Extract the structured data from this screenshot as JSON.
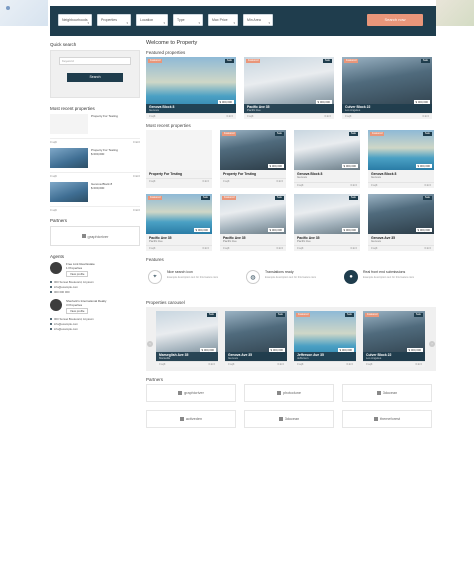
{
  "header": {
    "filters": [
      "Neighbourhoods",
      "Properties",
      "Location",
      "Type",
      "Max Price",
      "Min Area"
    ],
    "search_label": "Search now"
  },
  "sidebar": {
    "quick_search_title": "Quick search",
    "quick_search_placeholder": "Keyword",
    "quick_search_button": "Search",
    "recent_title": "Most recent properties",
    "recent": [
      {
        "title": "Property For Testing",
        "price": "",
        "meta_left": "0 sqft",
        "meta_right": "0 ⊞ 0"
      },
      {
        "title": "Property For Testing",
        "price": "$ 000,000",
        "meta_left": "0 sqft",
        "meta_right": "0 ⊞ 0"
      },
      {
        "title": "Genova Block 8",
        "price": "$ 000,000",
        "meta_left": "0 sqft",
        "meta_right": "0 ⊞ 0"
      }
    ],
    "partners_title": "Partners",
    "partner_name": "graphicriver",
    "agents_title": "Agents",
    "agents": [
      {
        "name": "Free Link Real Estate",
        "role": "1 Properties",
        "link": "View profile",
        "contacts": [
          "000 Sunset Boulevard, Anytown",
          "info@example.com",
          "000 000 000"
        ]
      },
      {
        "name": "Sherlock's International Realty",
        "role": "3 Properties",
        "link": "View profile",
        "contacts": [
          "000 Sunset Boulevard, Anytown",
          "info@example.com",
          "info@example.com"
        ]
      }
    ]
  },
  "main": {
    "welcome": "Welcome to Property",
    "featured_title": "Featured properties",
    "featured": [
      {
        "badge": "Featured",
        "status": "Sale",
        "price": "$ 000,000",
        "title": "Genova Block 8",
        "sub": "Genova",
        "meta_left": "0 sqft",
        "meta_right": "0 ⊞ 0",
        "photo": "pool"
      },
      {
        "badge": "Featured",
        "status": "Sale",
        "price": "$ 000,000",
        "title": "Pacific Ave 35",
        "sub": "Pacific Ave",
        "meta_left": "0 sqft",
        "meta_right": "0 ⊞ 0",
        "photo": "light"
      },
      {
        "badge": "Featured",
        "status": "Sale",
        "price": "$ 000,000",
        "title": "Culver Block 22",
        "sub": "Los Angeles",
        "meta_left": "0 sqft",
        "meta_right": "0 ⊞ 0",
        "photo": "dark"
      }
    ],
    "recent_title": "Most recent properties",
    "recent_row1": [
      {
        "badge": "",
        "status": "",
        "price": "",
        "title": "Property For Testing",
        "sub": "",
        "meta_left": "0 sqft",
        "meta_right": "0 ⊞ 0",
        "photo": "empty"
      },
      {
        "badge": "Featured",
        "status": "Sale",
        "price": "$ 000,000",
        "title": "Property For Testing",
        "sub": "",
        "meta_left": "0 sqft",
        "meta_right": "0 ⊞ 0",
        "photo": "dark"
      },
      {
        "badge": "",
        "status": "Sale",
        "price": "$ 000,000",
        "title": "Genova Block 8",
        "sub": "Genova",
        "meta_left": "0 sqft",
        "meta_right": "0 ⊞ 0",
        "photo": "light"
      },
      {
        "badge": "Featured",
        "status": "Sale",
        "price": "$ 000,000",
        "title": "Genova Block 8",
        "sub": "Genova",
        "meta_left": "0 sqft",
        "meta_right": "0 ⊞ 0",
        "photo": "pool"
      }
    ],
    "recent_row2": [
      {
        "badge": "Featured",
        "status": "Sale",
        "price": "$ 000,000",
        "title": "Pacific Ave 35",
        "sub": "Pacific Ave",
        "meta_left": "0 sqft",
        "meta_right": "0 ⊞ 0",
        "photo": "pool"
      },
      {
        "badge": "Featured",
        "status": "Sale",
        "price": "$ 000,000",
        "title": "Pacific Ave 35",
        "sub": "Pacific Ave",
        "meta_left": "0 sqft",
        "meta_right": "0 ⊞ 0",
        "photo": "light"
      },
      {
        "badge": "",
        "status": "Sale",
        "price": "$ 000,000",
        "title": "Pacific Ave 35",
        "sub": "Pacific Ave",
        "meta_left": "0 sqft",
        "meta_right": "0 ⊞ 0",
        "photo": "light"
      },
      {
        "badge": "",
        "status": "Sale",
        "price": "$ 000,000",
        "title": "Genova Ave 35",
        "sub": "Genova",
        "meta_left": "0 sqft",
        "meta_right": "0 ⊞ 0",
        "photo": "dark"
      }
    ],
    "features_title": "Features",
    "features": [
      {
        "icon": "map-pin-icon",
        "title": "Nice search icon",
        "desc": "Example description text for this feature item"
      },
      {
        "icon": "globe-icon",
        "title": "Translations ready",
        "desc": "Example description text for this feature item"
      },
      {
        "icon": "user-icon",
        "title": "Real front end submissions",
        "desc": "Example description text for this feature item"
      }
    ],
    "carousel_title": "Properties carousel",
    "carousel": [
      {
        "badge": "",
        "status": "Sale",
        "price": "$ 000,000",
        "title": "Marseglish Ave 35",
        "sub": "Marseille",
        "meta_left": "0 sqft",
        "meta_right": "0 ⊞ 0",
        "photo": "light"
      },
      {
        "badge": "",
        "status": "Sale",
        "price": "$ 000,000",
        "title": "Genova Ave 35",
        "sub": "Genova",
        "meta_left": "0 sqft",
        "meta_right": "0 ⊞ 0",
        "photo": "dark"
      },
      {
        "badge": "Featured",
        "status": "Sale",
        "price": "$ 000,000",
        "title": "Jefferson Ave 35",
        "sub": "Jefferson",
        "meta_left": "0 sqft",
        "meta_right": "0 ⊞ 0",
        "photo": "pool"
      },
      {
        "badge": "Featured",
        "status": "Sale",
        "price": "$ 000,000",
        "title": "Culver Block 22",
        "sub": "Los Angeles",
        "meta_left": "0 sqft",
        "meta_right": "0 ⊞ 0",
        "photo": "dark"
      }
    ],
    "partners_title": "Partners",
    "partners": [
      "graphicriver",
      "photodune",
      "3docean",
      "activeden",
      "3docean",
      "themeforest"
    ]
  },
  "colors": {
    "primary": "#1f3d4d",
    "accent": "#e9967a",
    "panel": "#f0f0f0"
  }
}
